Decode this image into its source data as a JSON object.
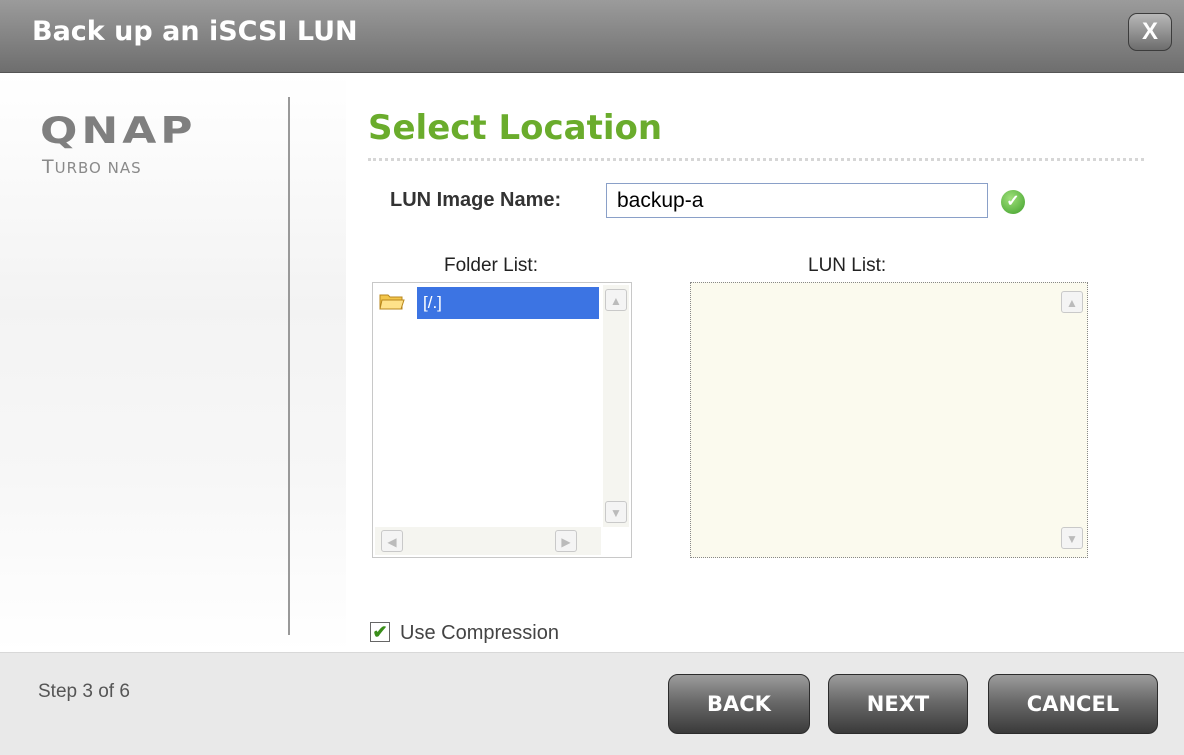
{
  "window": {
    "title": "Back up an iSCSI LUN",
    "close_glyph": "X",
    "close_icon": "close-icon"
  },
  "brand": {
    "logo": "QNAP",
    "subtitle": "Turbo NAS"
  },
  "page": {
    "heading": "Select Location"
  },
  "lun_image": {
    "label": "LUN Image Name:",
    "value": "backup-a",
    "valid_icon": "check-circle-icon",
    "valid_glyph": "✓"
  },
  "folder_list": {
    "label": "Folder List:",
    "items": [
      {
        "name": "[/.]",
        "icon": "folder-open-icon",
        "selected": true
      }
    ]
  },
  "lun_list": {
    "label": "LUN List:",
    "items": []
  },
  "options": {
    "use_compression": {
      "label": "Use Compression",
      "checked": true,
      "glyph": "✔"
    }
  },
  "footer": {
    "step": "Step 3 of 6",
    "back_label": "BACK",
    "next_label": "NEXT",
    "cancel_label": "CANCEL"
  },
  "colors": {
    "accent_green": "#6aac2c",
    "selection_blue": "#3c74e3",
    "lun_list_bg": "#fbfaee"
  }
}
